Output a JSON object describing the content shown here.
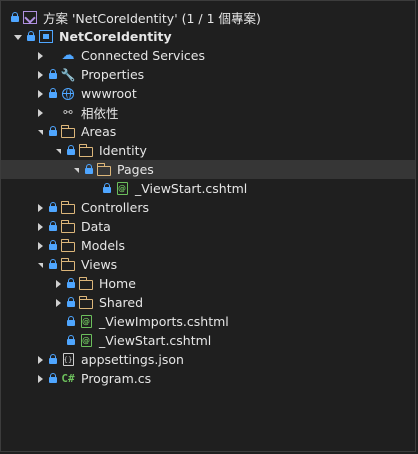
{
  "solution": {
    "label": "方案 'NetCoreIdentity' (1 / 1 個專案)"
  },
  "project": {
    "label": "NetCoreIdentity"
  },
  "items": {
    "connected_services": "Connected Services",
    "properties": "Properties",
    "wwwroot": "wwwroot",
    "dependencies": "相依性",
    "areas": "Areas",
    "identity": "Identity",
    "pages": "Pages",
    "viewstart_areas": "_ViewStart.cshtml",
    "controllers": "Controllers",
    "data": "Data",
    "models": "Models",
    "views": "Views",
    "home": "Home",
    "shared": "Shared",
    "viewimports": "_ViewImports.cshtml",
    "viewstart_views": "_ViewStart.cshtml",
    "appsettings": "appsettings.json",
    "program": "Program.cs"
  },
  "icons": {
    "json_glyph": "{}",
    "razor_glyph": "@",
    "csharp_glyph": "C#"
  }
}
